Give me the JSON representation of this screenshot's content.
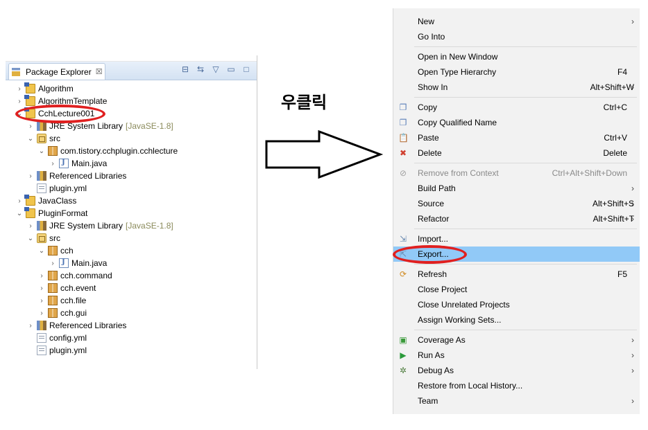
{
  "left_panel": {
    "tab_label": "Package Explorer",
    "tab_close": "☒",
    "tree": [
      {
        "text": "Algorithm",
        "icon": "project-icon",
        "kind": "project",
        "indent": 0,
        "twisty": "›"
      },
      {
        "text": "AlgorithmTemplate",
        "icon": "project-icon",
        "kind": "project",
        "indent": 0,
        "twisty": "›"
      },
      {
        "text": "CchLecture001",
        "icon": "project-icon",
        "kind": "project",
        "indent": 0,
        "twisty": "⌄"
      },
      {
        "text": "JRE System Library",
        "decoration": "[JavaSE-1.8]",
        "icon": "library-icon",
        "kind": "library",
        "indent": 1,
        "twisty": "›"
      },
      {
        "text": "src",
        "icon": "source-folder-icon",
        "kind": "srcfolder",
        "indent": 1,
        "twisty": "⌄"
      },
      {
        "text": "com.tistory.cchplugin.cchlecture",
        "icon": "package-icon",
        "kind": "package",
        "indent": 2,
        "twisty": "⌄"
      },
      {
        "text": "Main.java",
        "icon": "java-file-icon",
        "kind": "javafile",
        "indent": 3,
        "twisty": "›"
      },
      {
        "text": "Referenced Libraries",
        "icon": "library-icon",
        "kind": "library",
        "indent": 1,
        "twisty": "›"
      },
      {
        "text": "plugin.yml",
        "icon": "yml-file-icon",
        "kind": "ymlfile",
        "indent": 1,
        "twisty": ""
      },
      {
        "text": "JavaClass",
        "icon": "project-icon",
        "kind": "project",
        "indent": 0,
        "twisty": "›"
      },
      {
        "text": "PluginFormat",
        "icon": "project-icon",
        "kind": "project",
        "indent": 0,
        "twisty": "⌄"
      },
      {
        "text": "JRE System Library",
        "decoration": "[JavaSE-1.8]",
        "icon": "library-icon",
        "kind": "library",
        "indent": 1,
        "twisty": "›"
      },
      {
        "text": "src",
        "icon": "source-folder-icon",
        "kind": "srcfolder",
        "indent": 1,
        "twisty": "⌄"
      },
      {
        "text": "cch",
        "icon": "package-icon",
        "kind": "package",
        "indent": 2,
        "twisty": "⌄"
      },
      {
        "text": "Main.java",
        "icon": "java-file-icon",
        "kind": "javafile",
        "indent": 3,
        "twisty": "›"
      },
      {
        "text": "cch.command",
        "icon": "package-icon",
        "kind": "package",
        "indent": 2,
        "twisty": "›"
      },
      {
        "text": "cch.event",
        "icon": "package-icon",
        "kind": "package",
        "indent": 2,
        "twisty": "›"
      },
      {
        "text": "cch.file",
        "icon": "package-icon",
        "kind": "package",
        "indent": 2,
        "twisty": "›"
      },
      {
        "text": "cch.gui",
        "icon": "package-icon",
        "kind": "package",
        "indent": 2,
        "twisty": "›"
      },
      {
        "text": "Referenced Libraries",
        "icon": "library-icon",
        "kind": "library",
        "indent": 1,
        "twisty": "›"
      },
      {
        "text": "config.yml",
        "icon": "yml-file-icon",
        "kind": "ymlfile",
        "indent": 1,
        "twisty": ""
      },
      {
        "text": "plugin.yml",
        "icon": "yml-file-icon",
        "kind": "ymlfile",
        "indent": 1,
        "twisty": ""
      }
    ]
  },
  "annotation": {
    "right_click_label": "우클릭"
  },
  "menu": {
    "items": [
      {
        "label": "New",
        "shortcut": "",
        "submenu": true,
        "icon": "",
        "name": "menu-item-new"
      },
      {
        "label": "Go Into",
        "shortcut": "",
        "submenu": false,
        "icon": "",
        "name": "menu-item-go-into"
      },
      {
        "sep": true
      },
      {
        "label": "Open in New Window",
        "shortcut": "",
        "submenu": false,
        "icon": "",
        "name": "menu-item-open-new-window"
      },
      {
        "label": "Open Type Hierarchy",
        "shortcut": "F4",
        "submenu": false,
        "icon": "",
        "name": "menu-item-open-type-hierarchy"
      },
      {
        "label": "Show In",
        "shortcut": "Alt+Shift+W",
        "submenu": true,
        "icon": "",
        "name": "menu-item-show-in"
      },
      {
        "sep": true
      },
      {
        "label": "Copy",
        "shortcut": "Ctrl+C",
        "submenu": false,
        "icon": "copy-icon",
        "name": "menu-item-copy"
      },
      {
        "label": "Copy Qualified Name",
        "shortcut": "",
        "submenu": false,
        "icon": "copy-qualified-name-icon",
        "name": "menu-item-copy-qualified-name"
      },
      {
        "label": "Paste",
        "shortcut": "Ctrl+V",
        "submenu": false,
        "icon": "paste-icon",
        "name": "menu-item-paste"
      },
      {
        "label": "Delete",
        "shortcut": "Delete",
        "submenu": false,
        "icon": "delete-icon",
        "name": "menu-item-delete"
      },
      {
        "sep": true
      },
      {
        "label": "Remove from Context",
        "shortcut": "Ctrl+Alt+Shift+Down",
        "submenu": false,
        "icon": "remove-context-icon",
        "disabled": true,
        "name": "menu-item-remove-from-context"
      },
      {
        "label": "Build Path",
        "shortcut": "",
        "submenu": true,
        "icon": "",
        "name": "menu-item-build-path"
      },
      {
        "label": "Source",
        "shortcut": "Alt+Shift+S",
        "submenu": true,
        "icon": "",
        "name": "menu-item-source"
      },
      {
        "label": "Refactor",
        "shortcut": "Alt+Shift+T",
        "submenu": true,
        "icon": "",
        "name": "menu-item-refactor"
      },
      {
        "sep": true
      },
      {
        "label": "Import...",
        "shortcut": "",
        "submenu": false,
        "icon": "import-icon",
        "name": "menu-item-import"
      },
      {
        "label": "Export...",
        "shortcut": "",
        "submenu": false,
        "icon": "export-icon",
        "highlighted": true,
        "name": "menu-item-export"
      },
      {
        "sep": true
      },
      {
        "label": "Refresh",
        "shortcut": "F5",
        "submenu": false,
        "icon": "refresh-icon",
        "name": "menu-item-refresh"
      },
      {
        "label": "Close Project",
        "shortcut": "",
        "submenu": false,
        "icon": "",
        "name": "menu-item-close-project"
      },
      {
        "label": "Close Unrelated Projects",
        "shortcut": "",
        "submenu": false,
        "icon": "",
        "name": "menu-item-close-unrelated-projects"
      },
      {
        "label": "Assign Working Sets...",
        "shortcut": "",
        "submenu": false,
        "icon": "",
        "name": "menu-item-assign-working-sets"
      },
      {
        "sep": true
      },
      {
        "label": "Coverage As",
        "shortcut": "",
        "submenu": true,
        "icon": "coverage-icon",
        "name": "menu-item-coverage-as"
      },
      {
        "label": "Run As",
        "shortcut": "",
        "submenu": true,
        "icon": "run-icon",
        "name": "menu-item-run-as"
      },
      {
        "label": "Debug As",
        "shortcut": "",
        "submenu": true,
        "icon": "debug-icon",
        "name": "menu-item-debug-as"
      },
      {
        "label": "Restore from Local History...",
        "shortcut": "",
        "submenu": false,
        "icon": "",
        "name": "menu-item-restore-local-history"
      },
      {
        "label": "Team",
        "shortcut": "",
        "submenu": true,
        "icon": "",
        "name": "menu-item-team"
      }
    ],
    "submenu_glyph": "›"
  },
  "colors": {
    "highlight": "#91c9f7",
    "annotation_red": "#e02020",
    "tab_bar": "#d4e2f3"
  }
}
